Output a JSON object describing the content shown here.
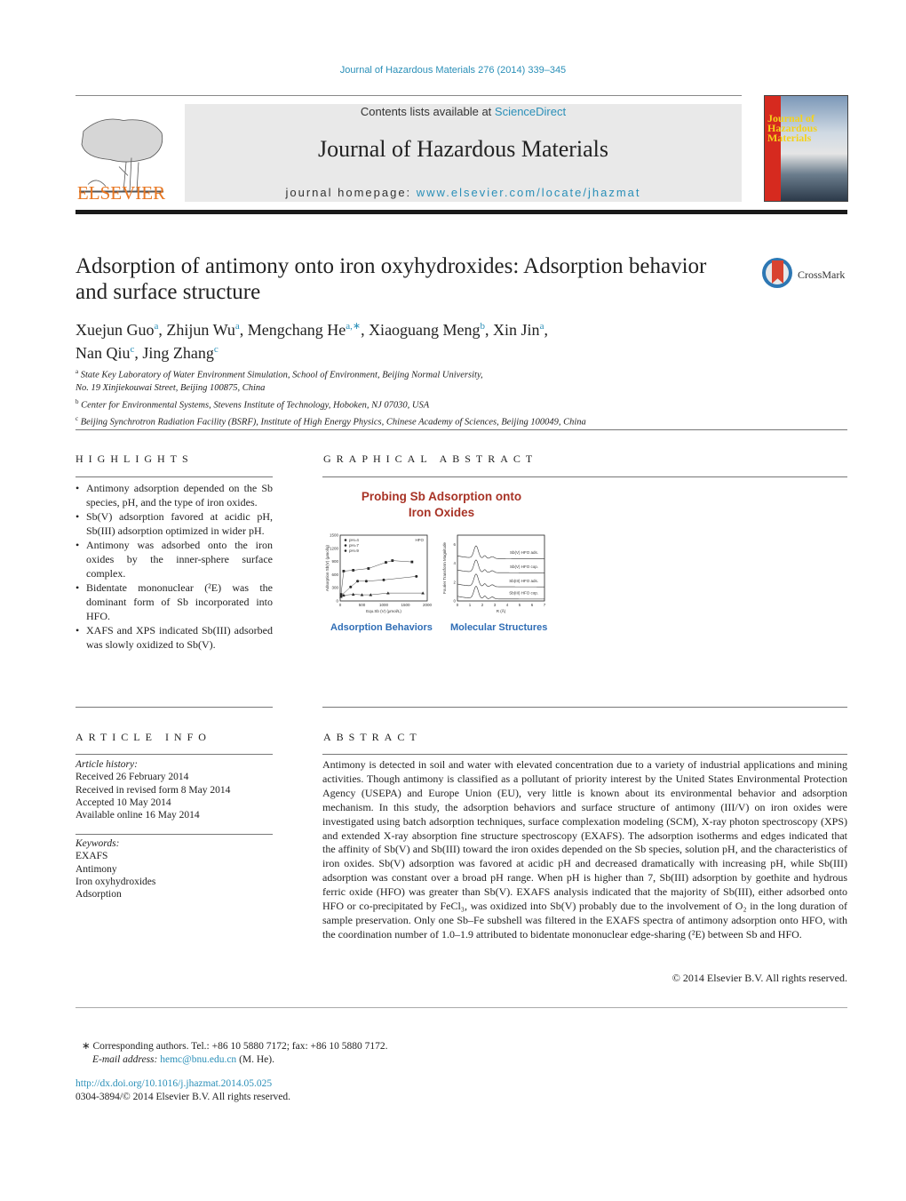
{
  "header": {
    "citation": "Journal of Hazardous Materials 276 (2014) 339–345",
    "contents_prefix": "Contents lists available at ",
    "contents_link": "ScienceDirect",
    "journal_title": "Journal of Hazardous Materials",
    "homepage_prefix": "journal homepage: ",
    "homepage_link": "www.elsevier.com/locate/jhazmat",
    "publisher_logo": "ELSEVIER",
    "cover_title": "Journal of Hazardous Materials",
    "accent_color": "#2a8fb8",
    "publisher_color": "#e87722"
  },
  "article": {
    "title": "Adsorption of antimony onto iron oxyhydroxides: Adsorption behavior and surface structure",
    "crossmark_label": "CrossMark",
    "authors": [
      {
        "name": "Xuejun Guo",
        "sup": "a"
      },
      {
        "name": "Zhijun Wu",
        "sup": "a"
      },
      {
        "name": "Mengchang He",
        "sup": "a,∗"
      },
      {
        "name": "Xiaoguang Meng",
        "sup": "b"
      },
      {
        "name": "Xin Jin",
        "sup": "a"
      },
      {
        "name": "Nan Qiu",
        "sup": "c"
      },
      {
        "name": "Jing Zhang",
        "sup": "c"
      }
    ],
    "affiliations": [
      {
        "sup": "a",
        "line1": "State Key Laboratory of Water Environment Simulation, School of Environment, Beijing Normal University,",
        "line2": "No. 19 Xinjiekouwai Street, Beijing 100875, China"
      },
      {
        "sup": "b",
        "line1": "Center for Environmental Systems, Stevens Institute of Technology, Hoboken, NJ 07030, USA"
      },
      {
        "sup": "c",
        "line1": "Beijing Synchrotron Radiation Facility (BSRF), Institute of High Energy Physics, Chinese Academy of Sciences, Beijing 100049, China"
      }
    ]
  },
  "highlights": {
    "heading": "HIGHLIGHTS",
    "items": [
      "Antimony adsorption depended on the Sb species, pH, and the type of iron oxides.",
      "Sb(V) adsorption favored at acidic pH, Sb(III) adsorption optimized in wider pH.",
      "Antimony was adsorbed onto the iron oxides by the inner-sphere surface complex.",
      "Bidentate mononuclear (²E) was the dominant form of Sb incorporated into HFO.",
      "XAFS and XPS indicated Sb(III) adsorbed was slowly oxidized to Sb(V)."
    ]
  },
  "graphical_abstract": {
    "heading": "GRAPHICAL ABSTRACT",
    "title_line1": "Probing Sb Adsorption onto",
    "title_line2": "Iron Oxides",
    "caption_left": "Adsorption Behaviors",
    "caption_right": "Molecular Structures",
    "title_color": "#a83326",
    "caption_color": "#2f6db5"
  },
  "chart_data": [
    {
      "type": "scatter",
      "title": "",
      "xlabel": "Equ.Sb (V) (μmol/L)",
      "ylabel": "Adsorption Sb(V) (μmol/g)",
      "xlim": [
        0,
        2000
      ],
      "ylim": [
        0,
        1500
      ],
      "xticks": [
        "0",
        "500",
        "1000",
        "1500",
        "2000"
      ],
      "yticks": [
        "0",
        "300",
        "600",
        "900",
        "1200",
        "1500"
      ],
      "annotation": "HFO",
      "legend": "top-left",
      "series": [
        {
          "name": "pH=4",
          "marker": "square",
          "x": [
            20,
            80,
            300,
            650,
            1050,
            1200,
            1650
          ],
          "y": [
            150,
            680,
            700,
            740,
            880,
            920,
            890
          ]
        },
        {
          "name": "pH=7",
          "marker": "circle",
          "x": [
            20,
            240,
            400,
            600,
            1000,
            1750
          ],
          "y": [
            120,
            320,
            450,
            450,
            480,
            560
          ]
        },
        {
          "name": "pH=9",
          "marker": "triangle",
          "x": [
            20,
            80,
            300,
            500,
            700,
            1100,
            1900
          ],
          "y": [
            100,
            130,
            150,
            140,
            140,
            180,
            180
          ]
        }
      ]
    },
    {
      "type": "line",
      "title": "",
      "xlabel": "R (Å)",
      "ylabel": "Fourier Transform Magnitude",
      "xlim": [
        0,
        7
      ],
      "ylim": [
        0,
        7
      ],
      "xticks": [
        "0",
        "1",
        "2",
        "3",
        "4",
        "5",
        "6",
        "7"
      ],
      "yticks": [
        "0",
        "2",
        "4",
        "6"
      ],
      "series": [
        {
          "name": "Sb(V) HFO ads.",
          "offset": 4.5
        },
        {
          "name": "Sb(V) HFO cop.",
          "offset": 3.0
        },
        {
          "name": "Sb(III) HFO ads.",
          "offset": 1.5
        },
        {
          "name": "Sb(III) HFO cop.",
          "offset": 0.2
        }
      ]
    }
  ],
  "article_info": {
    "heading": "ARTICLE INFO",
    "history_label": "Article history:",
    "history": [
      "Received 26 February 2014",
      "Received in revised form 8 May 2014",
      "Accepted 10 May 2014",
      "Available online 16 May 2014"
    ],
    "keywords_label": "Keywords:",
    "keywords": [
      "EXAFS",
      "Antimony",
      "Iron oxyhydroxides",
      "Adsorption"
    ]
  },
  "abstract": {
    "heading": "ABSTRACT",
    "text": "Antimony is detected in soil and water with elevated concentration due to a variety of industrial applications and mining activities. Though antimony is classified as a pollutant of priority interest by the United States Environmental Protection Agency (USEPA) and Europe Union (EU), very little is known about its environmental behavior and adsorption mechanism. In this study, the adsorption behaviors and surface structure of antimony (III/V) on iron oxides were investigated using batch adsorption techniques, surface complexation modeling (SCM), X-ray photon spectroscopy (XPS) and extended X-ray absorption fine structure spectroscopy (EXAFS). The adsorption isotherms and edges indicated that the affinity of Sb(V) and Sb(III) toward the iron oxides depended on the Sb species, solution pH, and the characteristics of iron oxides. Sb(V) adsorption was favored at acidic pH and decreased dramatically with increasing pH, while Sb(III) adsorption was constant over a broad pH range. When pH is higher than 7, Sb(III) adsorption by goethite and hydrous ferric oxide (HFO) was greater than Sb(V). EXAFS analysis indicated that the majority of Sb(III), either adsorbed onto HFO or co-precipitated by FeCl₃, was oxidized into Sb(V) probably due to the involvement of O₂ in the long duration of sample preservation. Only one Sb–Fe subshell was filtered in the EXAFS spectra of antimony adsorption onto HFO, with the coordination number of 1.0–1.9 attributed to bidentate mononuclear edge-sharing (²E) between Sb and HFO.",
    "copyright": "© 2014 Elsevier B.V. All rights reserved."
  },
  "footer": {
    "corresponding": "∗  Corresponding authors. Tel.: +86 10 5880 7172; fax: +86 10 5880 7172.",
    "email_label": "E-mail address: ",
    "email": "hemc@bnu.edu.cn",
    "email_suffix": " (M. He).",
    "doi": "http://dx.doi.org/10.1016/j.jhazmat.2014.05.025",
    "issn": "0304-3894/© 2014 Elsevier B.V. All rights reserved."
  }
}
